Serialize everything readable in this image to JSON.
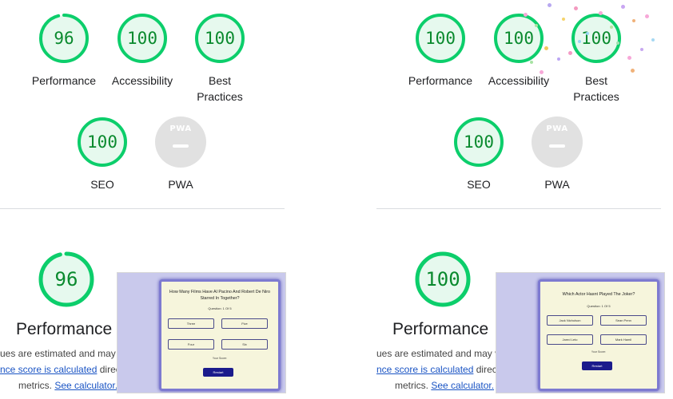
{
  "left_report": {
    "categories": [
      {
        "label": "96",
        "name": "Performance",
        "score": 96
      },
      {
        "label": "100",
        "name": "Accessibility",
        "score": 100
      },
      {
        "label": "100",
        "name_line1": "Best",
        "name_line2": "Practices",
        "score": 100
      },
      {
        "label": "100",
        "name": "SEO",
        "score": 100
      }
    ],
    "pwa": {
      "badge": "PWA",
      "name": "PWA",
      "value": "—"
    },
    "performance": {
      "score": 96,
      "label": "96",
      "title": "Performance"
    },
    "note": {
      "line1": "ues are estimated and may va",
      "link1": "nce score is calculated",
      "line2_after": " direct",
      "line3_before": "metrics. ",
      "link2": "See calculator."
    },
    "screenshot": {
      "question": "How Many Films Have Al Pacino And Robert De Niro Starred In Together?",
      "counter": "Question: 1 Of 5",
      "options": [
        "Three",
        "Five",
        "Four",
        "Six"
      ],
      "score_label": "Your Score:",
      "restart": "Restart"
    }
  },
  "right_report": {
    "categories": [
      {
        "label": "100",
        "name": "Performance",
        "score": 100
      },
      {
        "label": "100",
        "name": "Accessibility",
        "score": 100
      },
      {
        "label": "100",
        "name_line1": "Best",
        "name_line2": "Practices",
        "score": 100
      },
      {
        "label": "100",
        "name": "SEO",
        "score": 100
      }
    ],
    "pwa": {
      "badge": "PWA",
      "name": "PWA",
      "value": "—"
    },
    "performance": {
      "score": 100,
      "label": "100",
      "title": "Performance"
    },
    "note": {
      "line1": "ues are estimated and may va",
      "link1": "nce score is calculated",
      "line2_after": " direct",
      "line3_before": "metrics. ",
      "link2": "See calculator."
    },
    "screenshot": {
      "question": "Which Actor Hasnt Played The Joker?",
      "counter": "Question: 1 Of 5",
      "options": [
        "Jack Nicholson",
        "Sean Penn",
        "Jared Leto",
        "Mark Hamil"
      ],
      "score_label": "Your Score:",
      "restart": "Restart"
    }
  },
  "colors": {
    "pass_stroke": "#0cce6b",
    "pass_fill": "#e6f9ee",
    "pass_text": "#0a8a2e",
    "pwa_grey": "#e1e1e1",
    "link": "#1a54c4"
  }
}
